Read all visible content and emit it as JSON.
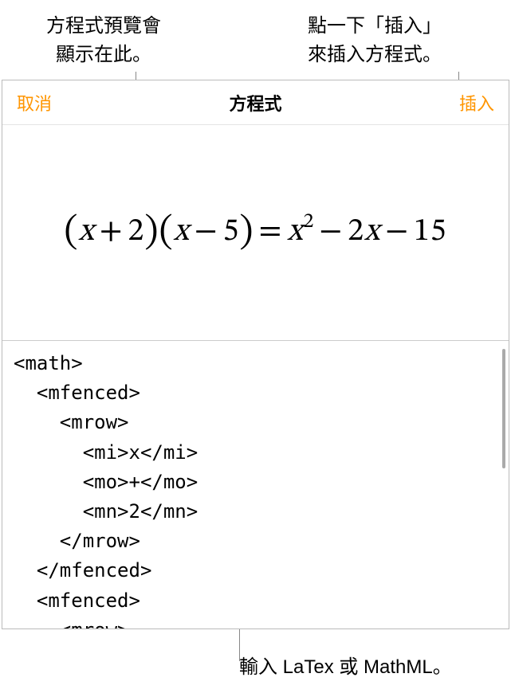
{
  "callouts": {
    "preview_hint": "方程式預覽會\n顯示在此。",
    "insert_hint": "點一下「插入」\n來插入方程式。",
    "input_hint": "輸入 LaTex 或 MathML。"
  },
  "toolbar": {
    "cancel": "取消",
    "title": "方程式",
    "insert": "插入"
  },
  "equation_preview": "(x + 2)(x − 5) = x² − 2x − 15",
  "editor_content": "<math>\n  <mfenced>\n    <mrow>\n      <mi>x</mi>\n      <mo>+</mo>\n      <mn>2</mn>\n    </mrow>\n  </mfenced>\n  <mfenced>\n    <mrow>"
}
